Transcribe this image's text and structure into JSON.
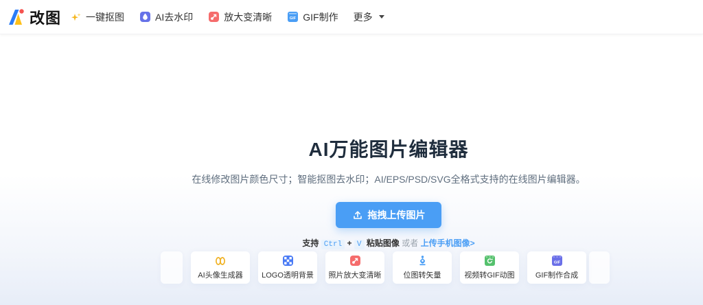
{
  "header": {
    "logo_text": "改图",
    "nav": [
      {
        "label": "一键抠图",
        "icon": "magic-wand-icon"
      },
      {
        "label": "AI去水印",
        "icon": "watermark-remove-icon"
      },
      {
        "label": "放大变清晰",
        "icon": "enlarge-icon"
      },
      {
        "label": "GIF制作",
        "icon": "gif-icon"
      }
    ],
    "more_label": "更多"
  },
  "hero": {
    "title": "AI万能图片编辑器",
    "subtitle": "在线修改图片颜色尺寸；智能抠图去水印；AI/EPS/PSD/SVG全格式支持的在线图片编辑器。",
    "upload_button_label": "拖拽上传图片",
    "tip": {
      "prefix": "支持",
      "key1": "Ctrl",
      "plus": "+",
      "key2": "V",
      "paste": "粘贴图像",
      "or": "或者",
      "mobile_link": "上传手机图像>"
    }
  },
  "features": [
    {
      "label": "AI头像生成器",
      "icon": "avatar-generator-icon"
    },
    {
      "label": "LOGO透明背景",
      "icon": "transparent-bg-icon"
    },
    {
      "label": "照片放大变清晰",
      "icon": "photo-enlarge-icon"
    },
    {
      "label": "位图转矢量",
      "icon": "vector-pen-icon"
    },
    {
      "label": "视频转GIF动图",
      "icon": "video-to-gif-icon"
    },
    {
      "label": "GIF制作合成",
      "icon": "gif-compose-icon"
    }
  ],
  "icon_text": {
    "gif": "GIF"
  },
  "colors": {
    "primary_blue": "#4a9ef5",
    "logo_blue": "#2b7cf6",
    "logo_yellow": "#ffc019",
    "logo_red": "#f5524f",
    "wand_yellow": "#f5b61e",
    "indigo": "#6672e8",
    "red": "#f56c6c",
    "feature_yellow": "#f0b225",
    "feature_blue": "#4a7bf5",
    "feature_green": "#55c16d",
    "feature_indigo": "#6a6fe8",
    "bottom_bg": "#e7edf8"
  }
}
